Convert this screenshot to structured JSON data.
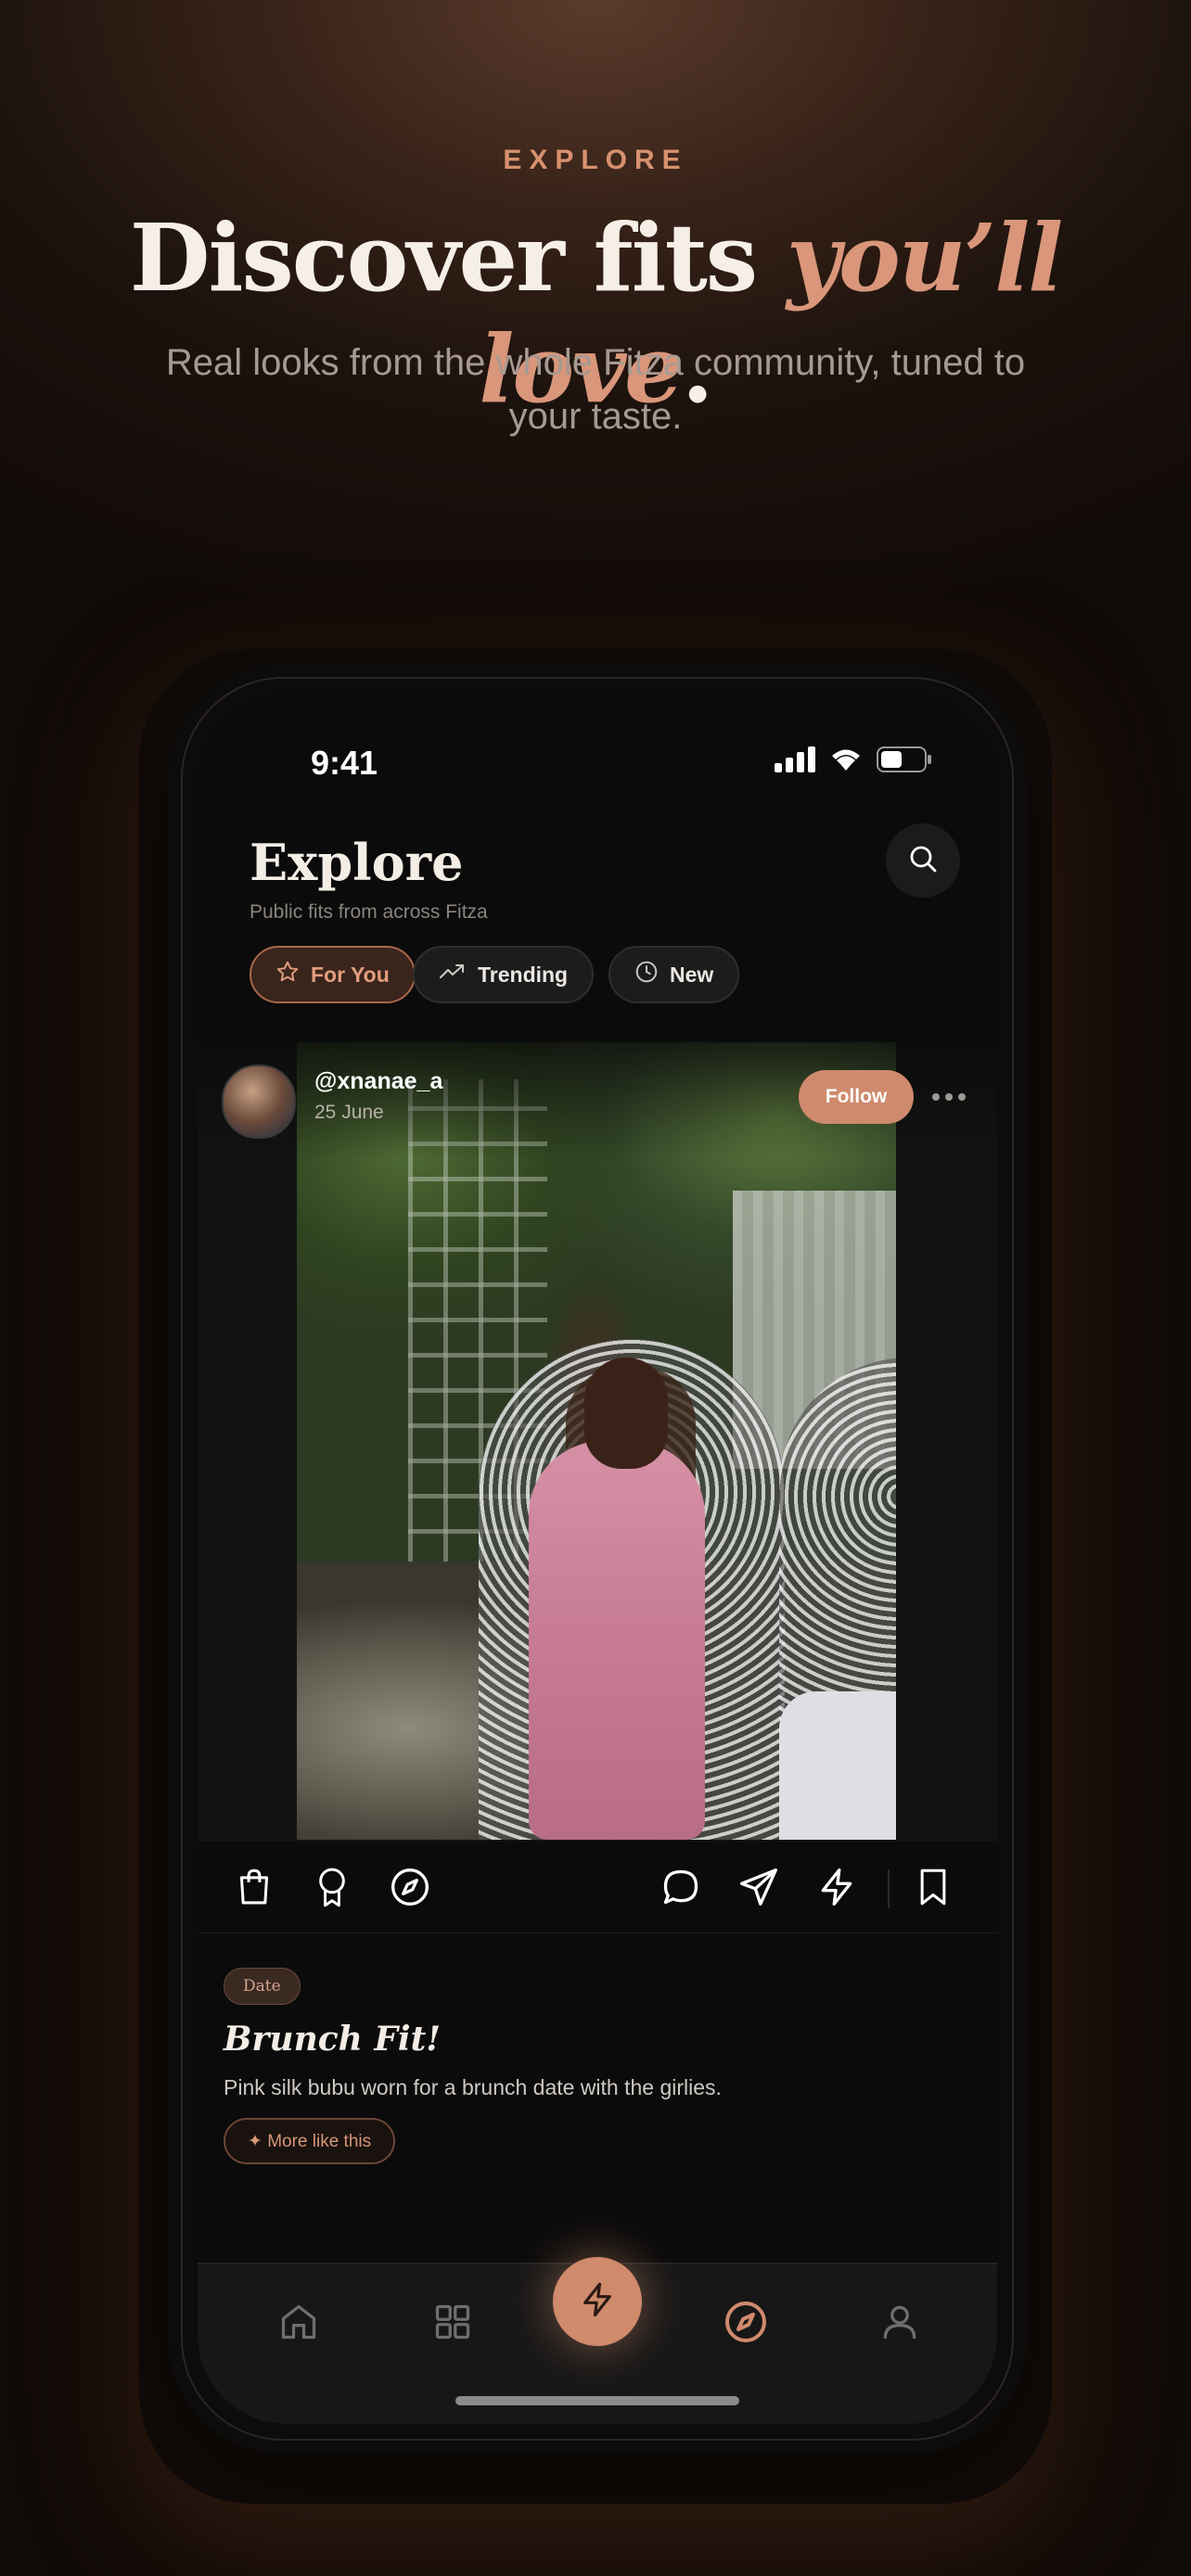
{
  "hero": {
    "eyebrow": "EXPLORE",
    "headline_part1": "Discover fits ",
    "headline_accent": "you’ll love",
    "headline_end": ".",
    "subhead": "Real looks from the whole Fitza community, tuned to your taste."
  },
  "status_bar": {
    "time": "9:41"
  },
  "header": {
    "title": "Explore",
    "subtitle": "Public fits from across Fitza"
  },
  "filters": [
    {
      "label": "For You",
      "icon": "star-icon",
      "active": true
    },
    {
      "label": "Trending",
      "icon": "trending-icon",
      "active": false
    },
    {
      "label": "New",
      "icon": "clock-icon",
      "active": false
    }
  ],
  "post": {
    "username": "@xnanae_a",
    "date": "25 June",
    "follow_label": "Follow",
    "tag": "Date",
    "title": "Brunch Fit!",
    "description": "Pink silk bubu worn for a brunch date with the girlies.",
    "more_like_label": "✦ More like this"
  },
  "actions": [
    "shopping-bag-icon",
    "award-icon",
    "compass-icon",
    "comment-icon",
    "send-icon",
    "bolt-icon",
    "bookmark-icon"
  ],
  "tabbar": {
    "items": [
      "home-icon",
      "grid-icon",
      "bolt-icon",
      "compass-icon",
      "profile-icon"
    ],
    "active": "compass-icon"
  },
  "colors": {
    "accent": "#d08a6c",
    "background": "#0b0b0b"
  }
}
